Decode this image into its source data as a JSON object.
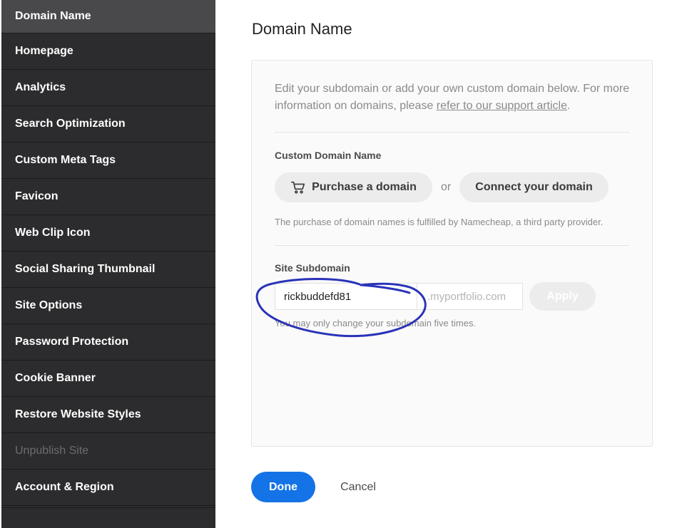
{
  "sidebar": {
    "items": [
      {
        "label": "Domain Name",
        "state": "active"
      },
      {
        "label": "Homepage"
      },
      {
        "label": "Analytics"
      },
      {
        "label": "Search Optimization"
      },
      {
        "label": "Custom Meta Tags"
      },
      {
        "label": "Favicon"
      },
      {
        "label": "Web Clip Icon"
      },
      {
        "label": "Social Sharing Thumbnail"
      },
      {
        "label": "Site Options"
      },
      {
        "label": "Password Protection"
      },
      {
        "label": "Cookie Banner"
      },
      {
        "label": "Restore Website Styles"
      },
      {
        "label": "Unpublish Site",
        "state": "disabled"
      },
      {
        "label": "Account & Region"
      }
    ]
  },
  "main": {
    "title": "Domain Name",
    "intro_text": "Edit your subdomain or add your own custom domain below. For more information on domains, please ",
    "intro_link": "refer to our support article",
    "intro_end": ".",
    "custom_domain": {
      "label": "Custom Domain Name",
      "purchase_label": "Purchase a domain",
      "purchase_icon": "cart-icon",
      "or_text": "or",
      "connect_label": "Connect your domain",
      "note": "The purchase of domain names is fulfilled by Namecheap, a third party provider."
    },
    "subdomain": {
      "label": "Site Subdomain",
      "value": "rickbuddefd81",
      "suffix": ".myportfolio.com",
      "apply_label": "Apply",
      "note": "You may only change your subdomain five times."
    },
    "actions": {
      "done_label": "Done",
      "cancel_label": "Cancel"
    }
  },
  "colors": {
    "sidebar_bg": "#2c2c2e",
    "sidebar_active": "#49494b",
    "accent": "#1473e6",
    "annotation": "#2a33b8"
  }
}
